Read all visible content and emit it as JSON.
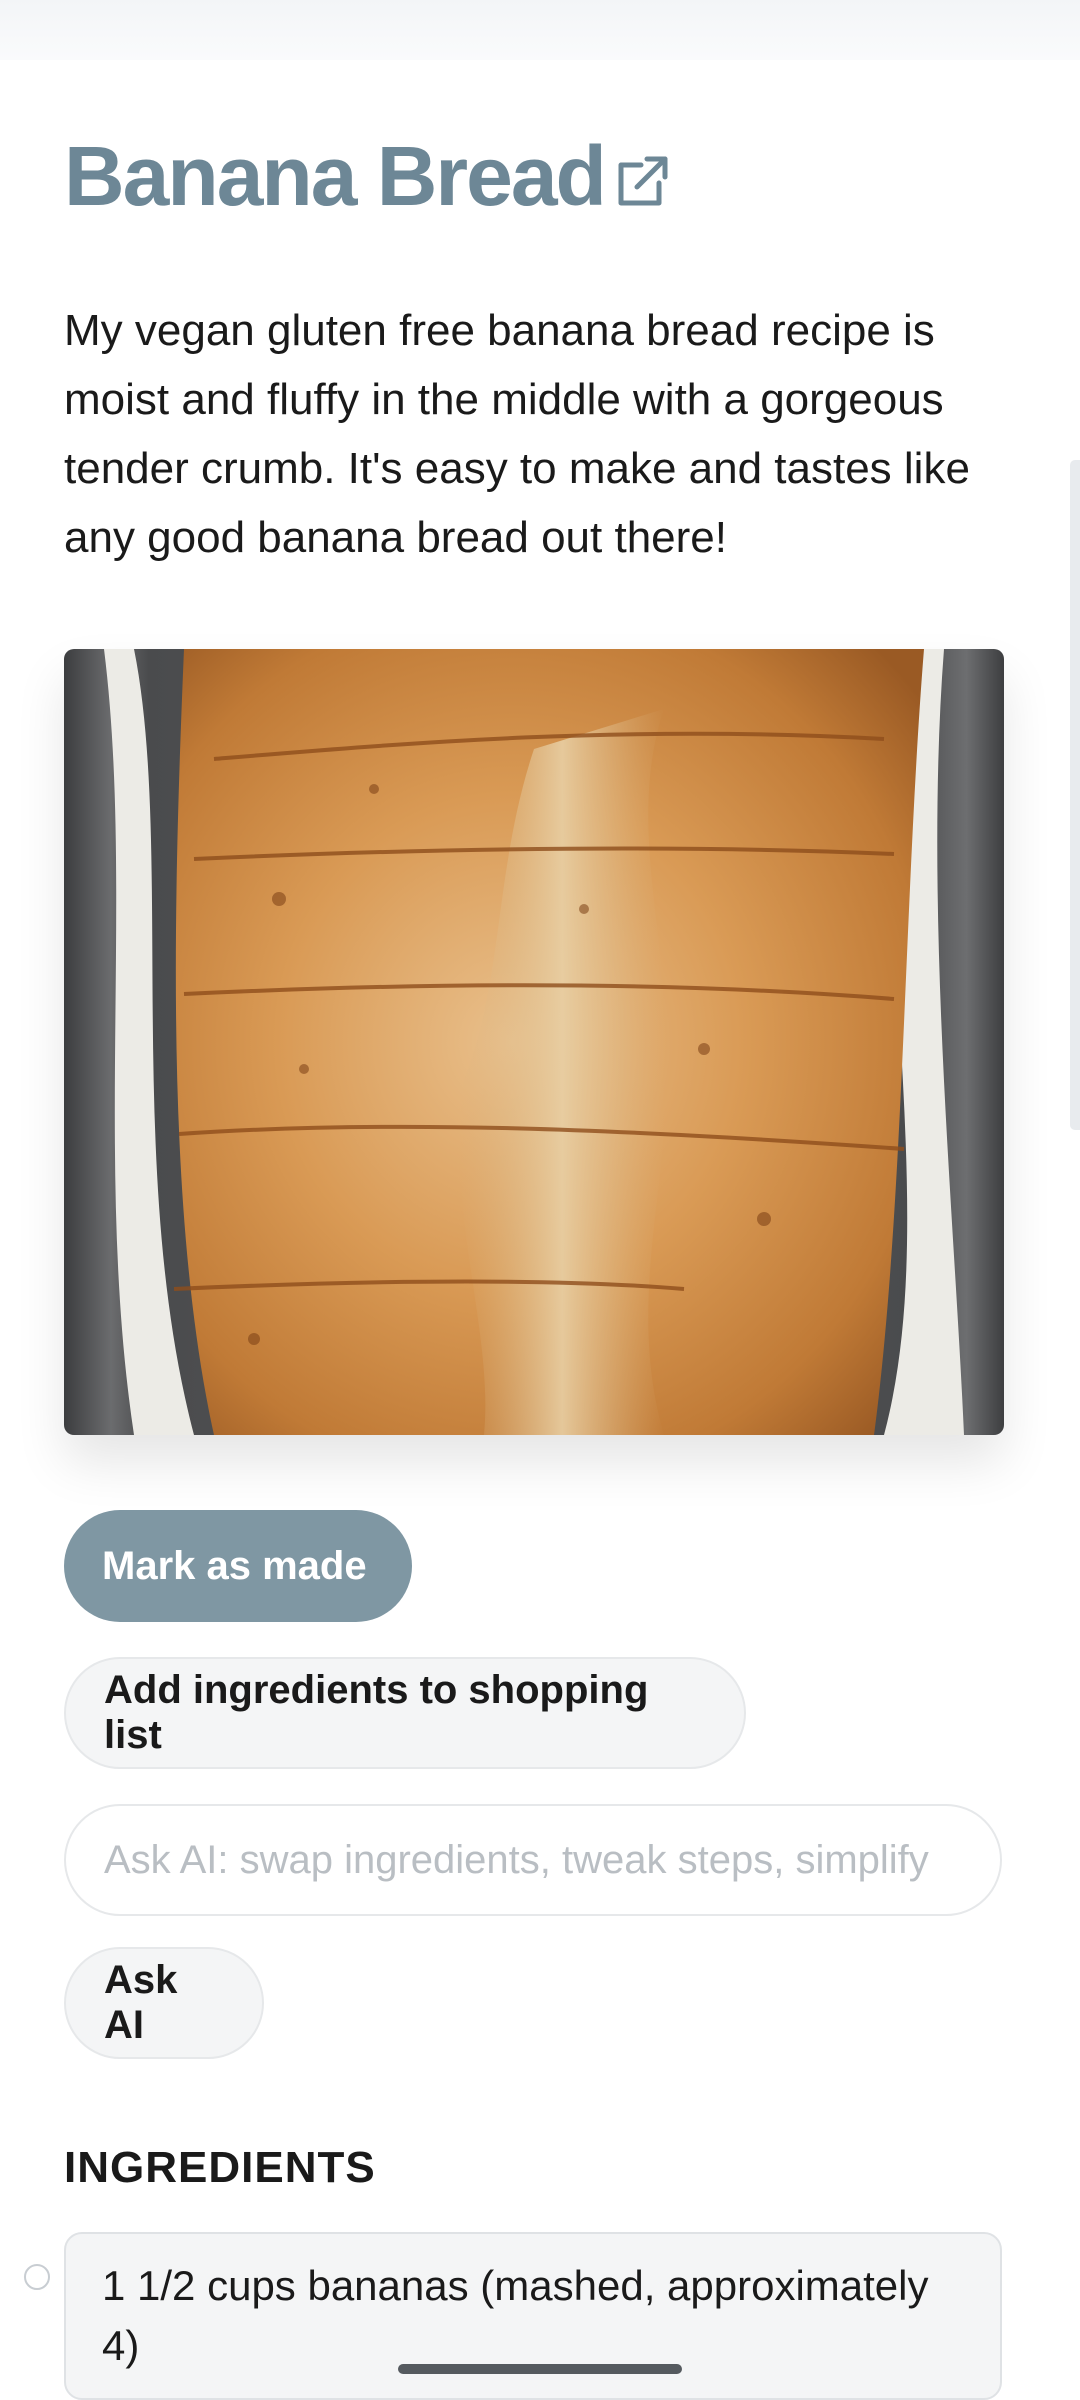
{
  "recipe": {
    "title": "Banana Bread",
    "description": "My vegan gluten free banana bread recipe is moist and fluffy in the middle with a gorgeous tender crumb. It's easy to make and tastes like any good banana bread out there!",
    "external_link_icon": "external-link-icon",
    "image_alt": "banana bread"
  },
  "actions": {
    "mark_made_label": "Mark as made",
    "shopping_list_label": "Add ingredients to shopping list",
    "ask_ai_placeholder": "Ask AI: swap ingredients, tweak steps, simplify",
    "ask_ai_label": "Ask AI"
  },
  "ingredients": {
    "heading": "INGREDIENTS",
    "items": [
      {
        "text": "1 1/2 cups bananas (mashed, approximately 4)",
        "checked": false
      }
    ]
  },
  "colors": {
    "title": "#6d8796",
    "primary_button": "#7f97a3",
    "secondary_button": "#f4f5f6"
  }
}
